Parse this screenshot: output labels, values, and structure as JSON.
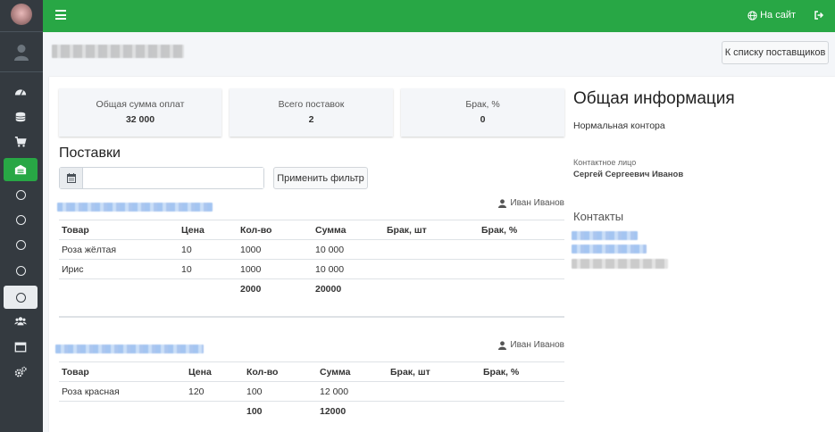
{
  "topbar": {
    "site_link": "На сайт"
  },
  "header": {
    "back_button": "К списку поставщиков"
  },
  "stats": [
    {
      "label": "Общая сумма оплат",
      "value": "32 000"
    },
    {
      "label": "Всего поставок",
      "value": "2"
    },
    {
      "label": "Брак, %",
      "value": "0"
    }
  ],
  "supplies": {
    "title": "Поставки",
    "date_placeholder": "",
    "filter_button": "Применить фильтр",
    "columns": [
      "Товар",
      "Цена",
      "Кол-во",
      "Сумма",
      "Брак, шт",
      "Брак, %"
    ],
    "deliveries": [
      {
        "manager": "Иван Иванов",
        "rows": [
          [
            "Роза жёлтая",
            "10",
            "1000",
            "10 000",
            "",
            ""
          ],
          [
            "Ирис",
            "10",
            "1000",
            "10 000",
            "",
            ""
          ]
        ],
        "total_qty": "2000",
        "total_sum": "20000"
      },
      {
        "manager": "Иван Иванов",
        "rows": [
          [
            "Роза красная",
            "120",
            "100",
            "12 000",
            "",
            ""
          ]
        ],
        "total_qty": "100",
        "total_sum": "12000"
      }
    ]
  },
  "info": {
    "title": "Общая информация",
    "type": "Нормальная контора",
    "contact_label": "Контактное лицо",
    "contact_name": "Сергей Сергеевич Иванов",
    "contacts_title": "Контакты"
  },
  "colors": {
    "accent": "#28a745",
    "sidebar": "#343a40"
  }
}
